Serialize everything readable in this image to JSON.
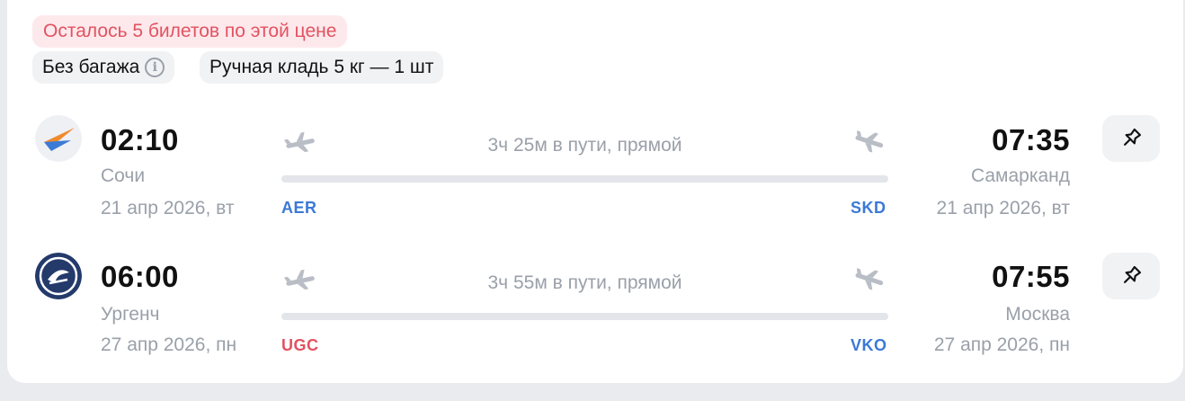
{
  "badges": {
    "tickets_left": "Осталось 5 билетов по этой цене",
    "baggage": "Без багажа",
    "hand_luggage": "Ручная кладь 5 кг — 1 шт"
  },
  "segments": [
    {
      "depart_time": "02:10",
      "depart_city": "Сочи",
      "depart_date": "21 апр 2026, вт",
      "depart_code": "AER",
      "depart_code_color": "#3b79d6",
      "duration": "3ч 25м в пути, прямой",
      "arrive_time": "07:35",
      "arrive_city": "Самарканд",
      "arrive_date": "21 апр 2026, вт",
      "arrive_code": "SKD",
      "arrive_code_color": "#3b79d6",
      "airline_icon": "airline-logo-orange-blue-wing"
    },
    {
      "depart_time": "06:00",
      "depart_city": "Ургенч",
      "depart_date": "27 апр 2026, пн",
      "depart_code": "UGC",
      "depart_code_color": "#e25260",
      "duration": "3ч 55м в пути, прямой",
      "arrive_time": "07:55",
      "arrive_city": "Москва",
      "arrive_date": "27 апр 2026, пн",
      "arrive_code": "VKO",
      "arrive_code_color": "#3b79d6",
      "airline_icon": "airline-logo-navy-circle"
    }
  ],
  "icons": {
    "info": "info-icon",
    "takeoff": "plane-takeoff-icon",
    "landing": "plane-landing-icon",
    "pin": "pin-icon"
  }
}
